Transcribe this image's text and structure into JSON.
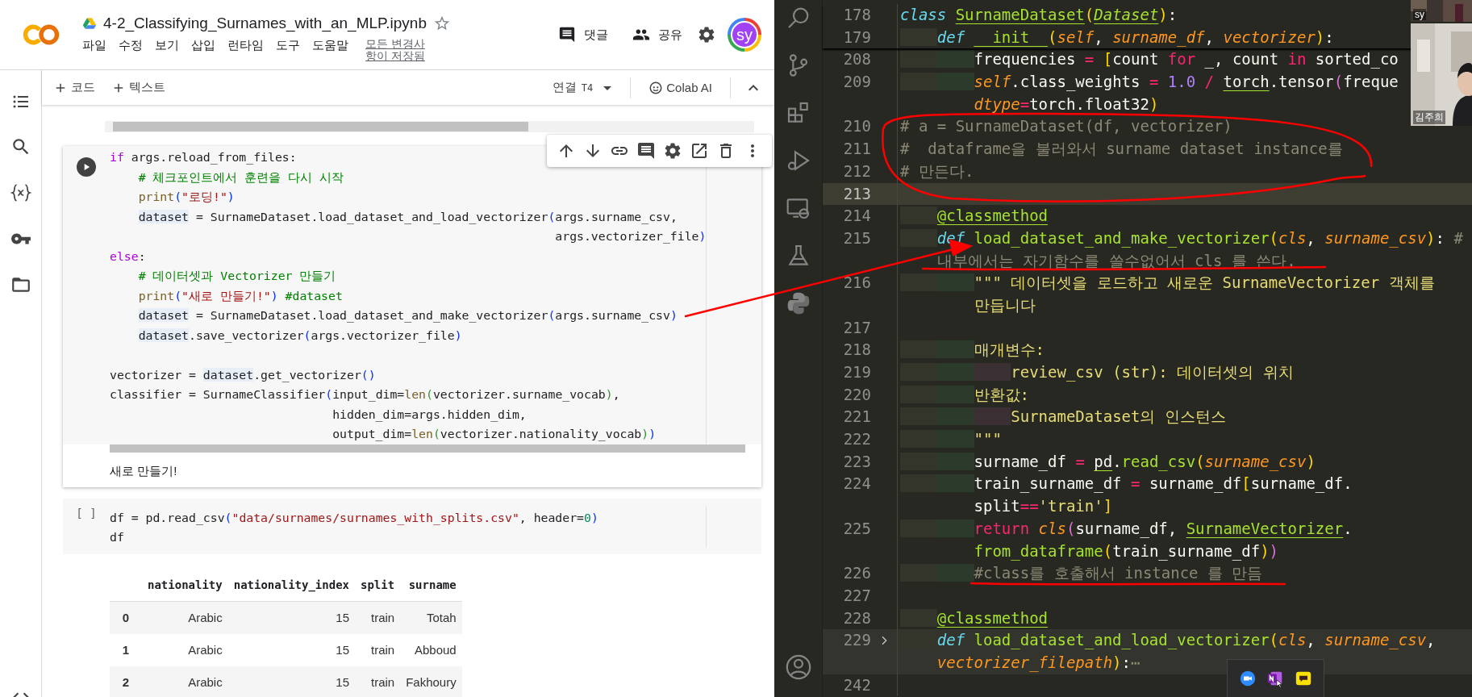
{
  "colab": {
    "title": "4-2_Classifying_Surnames_with_an_MLP.ipynb",
    "starred": false,
    "menu": [
      "파일",
      "수정",
      "보기",
      "삽입",
      "런타임",
      "도구",
      "도움말"
    ],
    "save_status": "모든 변경사항이 저장됨",
    "actions": [
      {
        "kind": "comment",
        "label": "댓글"
      },
      {
        "kind": "share",
        "label": "공유"
      }
    ],
    "avatar": "sy",
    "toolbar": {
      "add": [
        "코드",
        "텍스트"
      ],
      "runtime": "연결",
      "runtime_type": "T4",
      "ai": "Colab AI"
    },
    "cells": [
      {
        "focused": true,
        "lines": [
          {
            "segs": [
              {
                "kind": "k",
                "text": "if"
              },
              {
                "kind": "p",
                "text": " args.reload_from_files:"
              }
            ]
          },
          {
            "segs": [
              {
                "kind": "m",
                "text": "    # 체크포인트에서 훈련을 다시 시작"
              }
            ]
          },
          {
            "segs": [
              {
                "kind": "f",
                "text": "    print"
              },
              {
                "kind": "b",
                "text": "("
              },
              {
                "kind": "s",
                "text": "\"로딩!\""
              },
              {
                "kind": "b",
                "text": ")"
              }
            ]
          },
          {
            "segs": [
              {
                "kind": "h",
                "text": "    dataset"
              },
              {
                "kind": "p",
                "text": " = SurnameDataset.load_dataset_and_load_vectorizer"
              },
              {
                "kind": "b",
                "text": "("
              },
              {
                "kind": "p",
                "text": "args.surname_csv,"
              }
            ]
          },
          {
            "segs": [
              {
                "kind": "p",
                "text": "                                                              args.vectorizer_file"
              },
              {
                "kind": "b",
                "text": ")"
              }
            ]
          },
          {
            "segs": [
              {
                "kind": "k",
                "text": "else"
              },
              {
                "kind": "p",
                "text": ":"
              }
            ]
          },
          {
            "segs": [
              {
                "kind": "m",
                "text": "    # 데이터셋과 Vectorizer 만들기"
              }
            ]
          },
          {
            "segs": [
              {
                "kind": "f",
                "text": "    print"
              },
              {
                "kind": "b",
                "text": "("
              },
              {
                "kind": "s",
                "text": "\"새로 만들기!\""
              },
              {
                "kind": "b",
                "text": ")"
              },
              {
                "kind": "m",
                "text": " #dataset"
              }
            ]
          },
          {
            "segs": [
              {
                "kind": "h",
                "text": "    dataset"
              },
              {
                "kind": "p",
                "text": " = SurnameDataset.load_dataset_and_make_vectorizer"
              },
              {
                "kind": "b",
                "text": "("
              },
              {
                "kind": "p",
                "text": "args.surname_csv"
              },
              {
                "kind": "b",
                "text": ")"
              }
            ]
          },
          {
            "segs": [
              {
                "kind": "h",
                "text": "    dataset"
              },
              {
                "kind": "p",
                "text": ".save_vectorizer"
              },
              {
                "kind": "b",
                "text": "("
              },
              {
                "kind": "p",
                "text": "args.vectorizer_file"
              },
              {
                "kind": "b",
                "text": ")"
              }
            ]
          },
          {
            "gap_before": true,
            "segs": [
              {
                "kind": "p",
                "text": "vectorizer = "
              },
              {
                "kind": "h",
                "text": "dataset"
              },
              {
                "kind": "p",
                "text": ".get_vectorizer"
              },
              {
                "kind": "b",
                "text": "()"
              }
            ]
          },
          {
            "segs": [
              {
                "kind": "p",
                "text": "classifier = SurnameClassifier"
              },
              {
                "kind": "b",
                "text": "("
              },
              {
                "kind": "p",
                "text": "input_dim="
              },
              {
                "kind": "f",
                "text": "len"
              },
              {
                "kind": "g",
                "text": "("
              },
              {
                "kind": "p",
                "text": "vectorizer.surname_vocab"
              },
              {
                "kind": "g",
                "text": ")"
              },
              {
                "kind": "p",
                "text": ","
              }
            ]
          },
          {
            "segs": [
              {
                "kind": "p",
                "text": "                               hidden_dim=args.hidden_dim,"
              }
            ]
          },
          {
            "segs": [
              {
                "kind": "p",
                "text": "                               output_dim="
              },
              {
                "kind": "f",
                "text": "len"
              },
              {
                "kind": "g",
                "text": "("
              },
              {
                "kind": "p",
                "text": "vectorizer.nationality_vocab"
              },
              {
                "kind": "g",
                "text": ")"
              },
              {
                "kind": "b",
                "text": ")"
              }
            ]
          }
        ],
        "output": "새로 만들기!"
      },
      {
        "focused": false,
        "prompt": "[ ]",
        "lines": [
          {
            "segs": [
              {
                "kind": "p",
                "text": "df = pd.read_csv"
              },
              {
                "kind": "b",
                "text": "("
              },
              {
                "kind": "s",
                "text": "\"data/surnames/surnames_with_splits.csv\""
              },
              {
                "kind": "p",
                "text": ", header="
              },
              {
                "kind": "n",
                "text": "0"
              },
              {
                "kind": "b",
                "text": ")"
              }
            ]
          },
          {
            "segs": [
              {
                "kind": "p",
                "text": "df"
              }
            ]
          }
        ]
      }
    ],
    "table": {
      "columns": [
        "nationality",
        "nationality_index",
        "split",
        "surname"
      ],
      "rows": [
        {
          "index": "0",
          "cells": [
            "Arabic",
            "15",
            "train",
            "Totah"
          ]
        },
        {
          "index": "1",
          "cells": [
            "Arabic",
            "15",
            "train",
            "Abboud"
          ]
        },
        {
          "index": "2",
          "cells": [
            "Arabic",
            "15",
            "train",
            "Fakhoury"
          ]
        }
      ]
    }
  },
  "editor": {
    "sticky": [
      {
        "number": "178",
        "parts": [
          {
            "segs": [
              {
                "kind": "k",
                "text": "class "
              },
              {
                "kind": "c",
                "text": "SurnameDataset"
              },
              {
                "kind": "y",
                "text": "("
              },
              {
                "kind": "C",
                "text": "Dataset"
              },
              {
                "kind": "y",
                "text": ")"
              },
              {
                "kind": "p",
                "text": ":"
              }
            ]
          }
        ]
      },
      {
        "number": "179",
        "parts": [
          {
            "segs": [
              {
                "kind": "k",
                "text": "    def "
              },
              {
                "kind": "c",
                "text": "__init__"
              },
              {
                "kind": "y",
                "text": "("
              },
              {
                "kind": "a",
                "text": "self"
              },
              {
                "kind": "p",
                "text": ", "
              },
              {
                "kind": "a",
                "text": "surname_df"
              },
              {
                "kind": "p",
                "text": ", "
              },
              {
                "kind": "a",
                "text": "vectorizer"
              },
              {
                "kind": "y",
                "text": ")"
              },
              {
                "kind": "p",
                "text": ":"
              }
            ]
          }
        ]
      }
    ],
    "lines": [
      {
        "number": "208",
        "current": false,
        "folded": false,
        "parts": [
          {
            "segs": [
              {
                "kind": "p",
                "text": "        frequencies "
              },
              {
                "kind": "o",
                "text": "= "
              },
              {
                "kind": "y",
                "text": "["
              },
              {
                "kind": "p",
                "text": "count "
              },
              {
                "kind": "o",
                "text": "for"
              },
              {
                "kind": "p",
                "text": " _, count "
              },
              {
                "kind": "o",
                "text": "in"
              },
              {
                "kind": "p",
                "text": " sorted_co"
              }
            ]
          }
        ]
      },
      {
        "number": "209",
        "current": false,
        "folded": false,
        "parts": [
          {
            "segs": [
              {
                "kind": "a",
                "text": "        self"
              },
              {
                "kind": "p",
                "text": ".class_weights "
              },
              {
                "kind": "o",
                "text": "="
              },
              {
                "kind": "n",
                "text": " 1.0 "
              },
              {
                "kind": "o",
                "text": "/ "
              },
              {
                "kind": "u",
                "text": "torch"
              },
              {
                "kind": "p",
                "text": ".tensor"
              },
              {
                "kind": "v",
                "text": "("
              },
              {
                "kind": "p",
                "text": "freque"
              }
            ]
          },
          {
            "segs": [
              {
                "kind": "a",
                "text": "        dtype"
              },
              {
                "kind": "o",
                "text": "="
              },
              {
                "kind": "u",
                "text": "torch"
              },
              {
                "kind": "p",
                "text": ".float32"
              },
              {
                "kind": "y",
                "text": ")"
              }
            ]
          }
        ]
      },
      {
        "number": "210",
        "current": false,
        "folded": false,
        "parts": [
          {
            "segs": [
              {
                "kind": "m",
                "text": "# a = SurnameDataset(df, vectorizer)"
              }
            ]
          }
        ]
      },
      {
        "number": "211",
        "current": false,
        "folded": false,
        "parts": [
          {
            "segs": [
              {
                "kind": "m",
                "text": "#  dataframe을 불러와서 surname dataset instance를"
              }
            ]
          }
        ]
      },
      {
        "number": "212",
        "current": false,
        "folded": false,
        "parts": [
          {
            "segs": [
              {
                "kind": "m",
                "text": "# 만든다."
              }
            ]
          }
        ]
      },
      {
        "number": "213",
        "current": true,
        "folded": false
      },
      {
        "number": "214",
        "current": false,
        "folded": false,
        "parts": [
          {
            "segs": [
              {
                "kind": "c",
                "text": "    @classmethod"
              }
            ]
          }
        ]
      },
      {
        "number": "215",
        "current": false,
        "folded": false,
        "parts": [
          {
            "segs": [
              {
                "kind": "k",
                "text": "    def "
              },
              {
                "kind": "f",
                "text": "load_dataset_and_make_vectorizer"
              },
              {
                "kind": "y",
                "text": "("
              },
              {
                "kind": "a",
                "text": "cls"
              },
              {
                "kind": "p",
                "text": ", "
              },
              {
                "kind": "a",
                "text": "surname_csv"
              },
              {
                "kind": "y",
                "text": ")"
              },
              {
                "kind": "p",
                "text": ": "
              },
              {
                "kind": "m",
                "text": "#"
              }
            ]
          },
          {
            "segs": [
              {
                "kind": "m",
                "text": "    내부에서는 자기함수를 쓸수없어서 cls 를 쓴다."
              }
            ]
          }
        ]
      },
      {
        "number": "216",
        "current": false,
        "folded": false,
        "parts": [
          {
            "segs": [
              {
                "kind": "s",
                "text": "        \"\"\" 데이터셋을 로드하고 새로운 SurnameVectorizer 객체를"
              }
            ]
          },
          {
            "segs": [
              {
                "kind": "s",
                "text": "        만듭니다"
              }
            ]
          }
        ]
      },
      {
        "number": "217",
        "current": false,
        "folded": false
      },
      {
        "number": "218",
        "current": false,
        "folded": false,
        "parts": [
          {
            "segs": [
              {
                "kind": "s",
                "text": "        매개변수:"
              }
            ]
          }
        ]
      },
      {
        "number": "219",
        "current": false,
        "folded": false,
        "parts": [
          {
            "segs": [
              {
                "kind": "s",
                "text": "            review_csv (str): 데이터셋의 위치"
              }
            ]
          }
        ]
      },
      {
        "number": "220",
        "current": false,
        "folded": false,
        "parts": [
          {
            "segs": [
              {
                "kind": "s",
                "text": "        반환값:"
              }
            ]
          }
        ]
      },
      {
        "number": "221",
        "current": false,
        "folded": false,
        "parts": [
          {
            "segs": [
              {
                "kind": "s",
                "text": "            SurnameDataset의 인스턴스"
              }
            ]
          }
        ]
      },
      {
        "number": "222",
        "current": false,
        "folded": false,
        "parts": [
          {
            "segs": [
              {
                "kind": "s",
                "text": "        \"\"\""
              }
            ]
          }
        ]
      },
      {
        "number": "223",
        "current": false,
        "folded": false,
        "parts": [
          {
            "segs": [
              {
                "kind": "p",
                "text": "        surname_df "
              },
              {
                "kind": "o",
                "text": "= "
              },
              {
                "kind": "u",
                "text": "pd"
              },
              {
                "kind": "p",
                "text": "."
              },
              {
                "kind": "f",
                "text": "read_csv"
              },
              {
                "kind": "y",
                "text": "("
              },
              {
                "kind": "a",
                "text": "surname_csv"
              },
              {
                "kind": "y",
                "text": ")"
              }
            ]
          }
        ]
      },
      {
        "number": "224",
        "current": false,
        "folded": false,
        "parts": [
          {
            "segs": [
              {
                "kind": "p",
                "text": "        train_surname_df "
              },
              {
                "kind": "o",
                "text": "="
              },
              {
                "kind": "p",
                "text": " surname_df"
              },
              {
                "kind": "y",
                "text": "["
              },
              {
                "kind": "p",
                "text": "surname_df."
              }
            ]
          },
          {
            "segs": [
              {
                "kind": "p",
                "text": "        split"
              },
              {
                "kind": "o",
                "text": "=="
              },
              {
                "kind": "s",
                "text": "'train'"
              },
              {
                "kind": "y",
                "text": "]"
              }
            ]
          }
        ]
      },
      {
        "number": "225",
        "current": false,
        "folded": false,
        "parts": [
          {
            "segs": [
              {
                "kind": "o",
                "text": "        return "
              },
              {
                "kind": "a",
                "text": "cls"
              },
              {
                "kind": "v",
                "text": "("
              },
              {
                "kind": "p",
                "text": "surname_df, "
              },
              {
                "kind": "c",
                "text": "SurnameVectorizer"
              },
              {
                "kind": "p",
                "text": "."
              }
            ]
          },
          {
            "segs": [
              {
                "kind": "f",
                "text": "        from_dataframe"
              },
              {
                "kind": "y",
                "text": "("
              },
              {
                "kind": "p",
                "text": "train_surname_df"
              },
              {
                "kind": "y",
                "text": ")"
              },
              {
                "kind": "v",
                "text": ")"
              }
            ]
          }
        ]
      },
      {
        "number": "226",
        "current": false,
        "folded": false,
        "parts": [
          {
            "segs": [
              {
                "kind": "m",
                "text": "        #class를 호출해서 instance 를 만듬"
              }
            ]
          }
        ]
      },
      {
        "number": "227",
        "current": false,
        "folded": false
      },
      {
        "number": "228",
        "current": false,
        "folded": false,
        "parts": [
          {
            "segs": [
              {
                "kind": "c",
                "text": "    @classmethod"
              }
            ]
          }
        ]
      },
      {
        "number": "229",
        "current": false,
        "folded": true,
        "parts": [
          {
            "segs": [
              {
                "kind": "k",
                "text": "    def "
              },
              {
                "kind": "f",
                "text": "load_dataset_and_load_vectorizer"
              },
              {
                "kind": "y",
                "text": "("
              },
              {
                "kind": "a",
                "text": "cls"
              },
              {
                "kind": "p",
                "text": ", "
              },
              {
                "kind": "a",
                "text": "surname_csv"
              },
              {
                "kind": "p",
                "text": ","
              }
            ]
          },
          {
            "segs": [
              {
                "kind": "a",
                "text": "    vectorizer_filepath"
              },
              {
                "kind": "y",
                "text": ")"
              },
              {
                "kind": "p",
                "text": ":"
              },
              {
                "kind": "m",
                "text": "⋯"
              }
            ]
          }
        ]
      },
      {
        "number": "242",
        "current": false,
        "folded": false
      }
    ]
  },
  "video_tiles": [
    {
      "name": "sy"
    },
    {
      "name": "김주희"
    }
  ]
}
